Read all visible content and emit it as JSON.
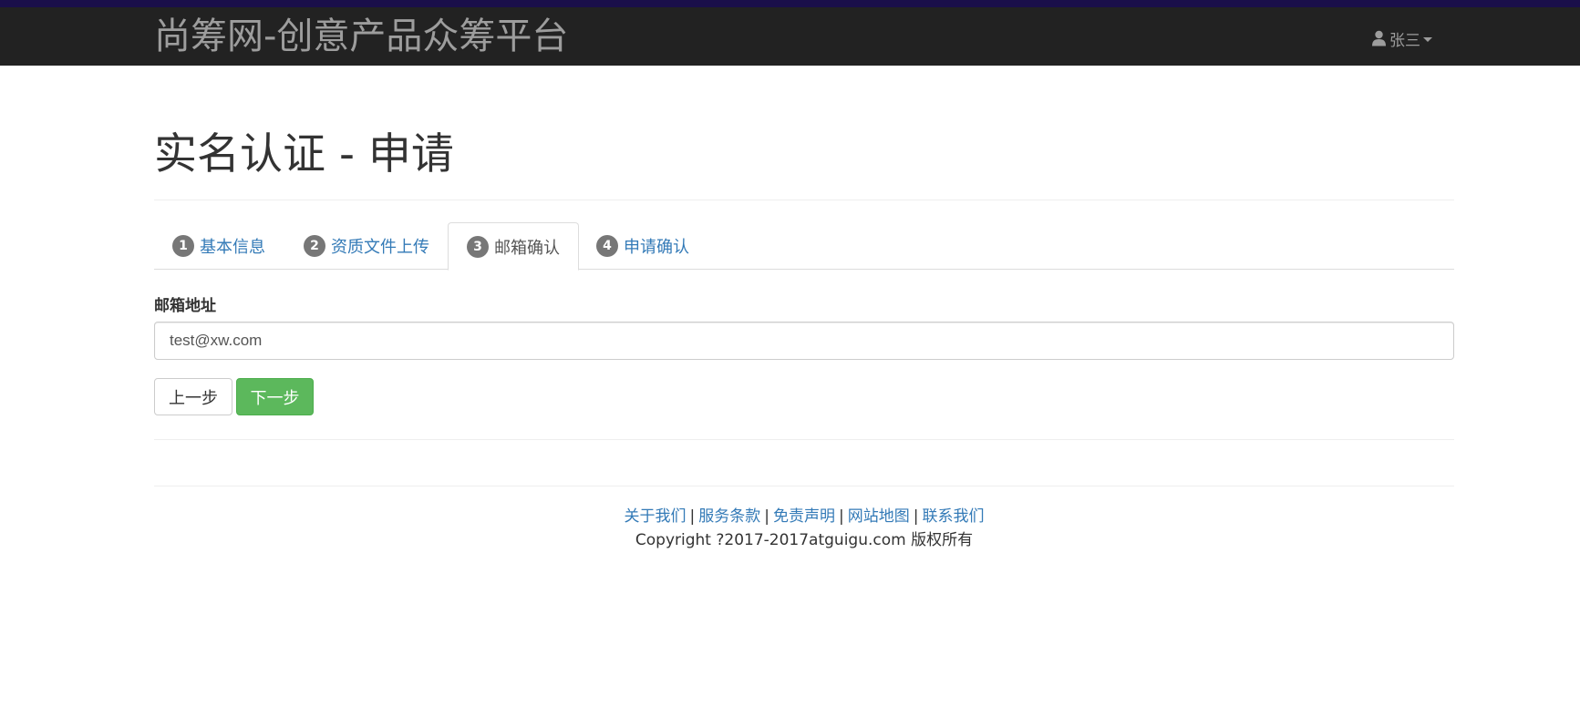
{
  "navbar": {
    "brand": "尚筹网-创意产品众筹平台",
    "user_name": "张三",
    "user_icon": "user-icon"
  },
  "page": {
    "title": "实名认证 - 申请"
  },
  "tabs": [
    {
      "number": "1",
      "label": "基本信息",
      "active": false
    },
    {
      "number": "2",
      "label": "资质文件上传",
      "active": false
    },
    {
      "number": "3",
      "label": "邮箱确认",
      "active": true
    },
    {
      "number": "4",
      "label": "申请确认",
      "active": false
    }
  ],
  "form": {
    "email_label": "邮箱地址",
    "email_value": "test@xw.com"
  },
  "buttons": {
    "prev_label": "上一步",
    "next_label": "下一步"
  },
  "footer": {
    "links": [
      "关于我们",
      "服务条款",
      "免责声明",
      "网站地图",
      "联系我们"
    ],
    "separator": "|",
    "copyright": "Copyright ?2017-2017atguigu.com 版权所有"
  },
  "colors": {
    "navbar_bg": "#222222",
    "link": "#337ab7",
    "success": "#5cb85c",
    "badge": "#777777"
  }
}
